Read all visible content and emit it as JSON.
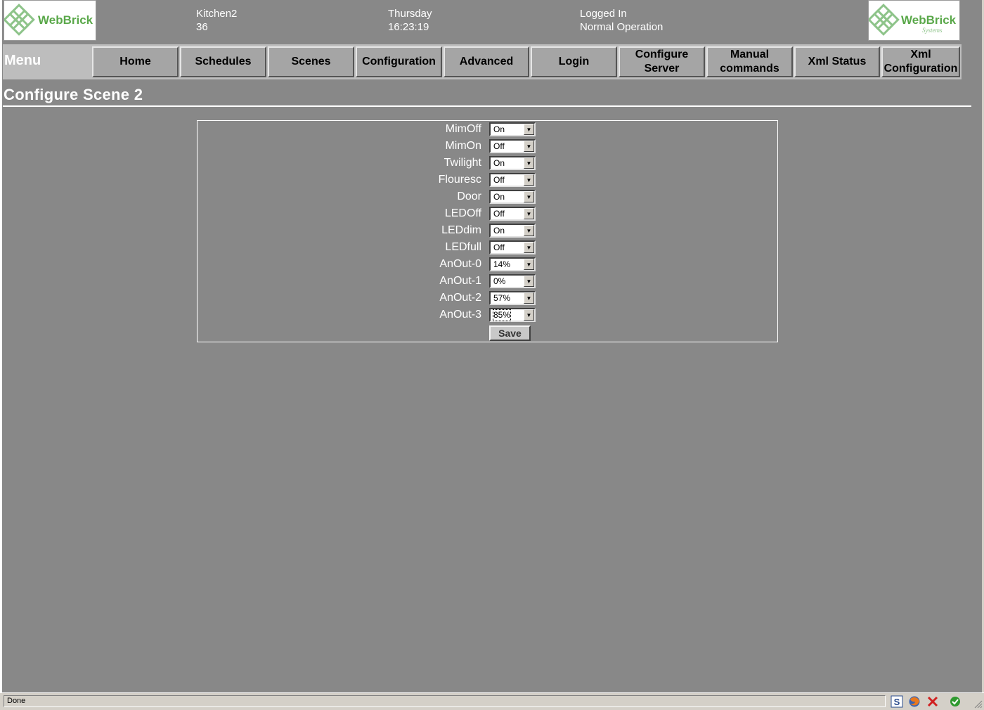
{
  "header": {
    "logo_left_text": "WebBrick",
    "logo_right_text": "WebBrick",
    "logo_right_sub": "Systems",
    "device_name": "Kitchen2",
    "device_number": "36",
    "day": "Thursday",
    "time": "16:23:19",
    "login_status": "Logged In",
    "operation_status": "Normal Operation"
  },
  "nav": {
    "menu_label": "Menu",
    "items": [
      {
        "line1": "Home",
        "line2": ""
      },
      {
        "line1": "Schedules",
        "line2": ""
      },
      {
        "line1": "Scenes",
        "line2": ""
      },
      {
        "line1": "Configuration",
        "line2": ""
      },
      {
        "line1": "Advanced",
        "line2": ""
      },
      {
        "line1": "Login",
        "line2": ""
      },
      {
        "line1": "Configure",
        "line2": "Server"
      },
      {
        "line1": "Manual",
        "line2": "commands"
      },
      {
        "line1": "Xml Status",
        "line2": ""
      },
      {
        "line1": "Xml",
        "line2": "Configuration"
      }
    ]
  },
  "page": {
    "title": "Configure Scene 2"
  },
  "form": {
    "rows": [
      {
        "label": "MimOff",
        "value": "On"
      },
      {
        "label": "MimOn",
        "value": "Off"
      },
      {
        "label": "Twilight",
        "value": "On"
      },
      {
        "label": "Flouresc",
        "value": "Off"
      },
      {
        "label": "Door",
        "value": "On"
      },
      {
        "label": "LEDOff",
        "value": "Off"
      },
      {
        "label": "LEDdim",
        "value": "On"
      },
      {
        "label": "LEDfull",
        "value": "Off"
      },
      {
        "label": "AnOut-0",
        "value": "14%"
      },
      {
        "label": "AnOut-1",
        "value": "0%"
      },
      {
        "label": "AnOut-2",
        "value": "57%"
      },
      {
        "label": "AnOut-3",
        "value": "85%"
      }
    ],
    "save_label": "Save"
  },
  "statusbar": {
    "text": "Done",
    "icons": [
      "s-icon",
      "firefox-icon",
      "stop-icon",
      "check-icon"
    ]
  },
  "colors": {
    "page_bg": "#888888",
    "nav_bg": "#bdbdbd",
    "nav_button": "#a5a5a5",
    "logo_green": "#5aa84a"
  }
}
